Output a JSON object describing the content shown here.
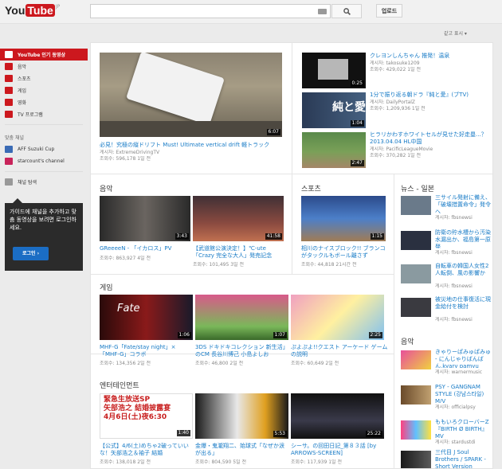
{
  "logo": {
    "you": "You",
    "tube": "Tube",
    "region": "JP"
  },
  "header": {
    "upload_label": "업로드",
    "show_hide": "같고 표시 ▾"
  },
  "guide": {
    "items": [
      {
        "label": "YouTube 인기 동영상"
      },
      {
        "label": "음악"
      },
      {
        "label": "스포츠"
      },
      {
        "label": "게임"
      },
      {
        "label": "영화"
      },
      {
        "label": "TV 프로그램"
      }
    ],
    "channels_heading": "맞춤 채널",
    "channels": [
      {
        "label": "AFF Suzuki Cup"
      },
      {
        "label": "starcount's channel"
      }
    ],
    "browse": "채널 탐색",
    "signin_text": "가이드에 채널을 추가하고 맞춤 동영상을 보려면 로그인하세요.",
    "signin_button": "로그인 ›"
  },
  "featured": {
    "main": {
      "duration": "6:07",
      "title": "必見！究極の縦ドリフト Must! Ultimate vertical drift 軽トラック",
      "channel": "게시자: ExtremeDrivingTV",
      "stats": "조회수: 596,178   1일 전"
    },
    "side": [
      {
        "duration": "0:25",
        "title": "クレヨンしんちゃん 推発！温泉",
        "channel": "게시자: takosuke1209",
        "stats": "조회수: 429,022   1일 전"
      },
      {
        "duration": "1:04",
        "title": "1分で振り返る朝ドラ『純と愛』(ブTV)",
        "channel": "게시자: DailyPortalZ",
        "stats": "조회수: 1,209,936   1일 전"
      },
      {
        "duration": "2:47",
        "title": "ヒラリかわすホワイトセルが見せた好走塁...？ 2013.04.04 HL中国",
        "channel": "게시자: PacificLeagueMovie",
        "stats": "조회수: 370,282   1일 전"
      }
    ]
  },
  "shelves": {
    "music": {
      "heading": "음악",
      "videos": [
        {
          "duration": "3:43",
          "title": "GReeeeN - 「イカロス」PV",
          "stats": "조회수: 863,927   4일 전"
        },
        {
          "duration": "41:58",
          "title": "【武道館公演決定！】℃-ute「Crazy 完全な大人」発売記念",
          "stats": "조회수: 101,495   3일 전"
        }
      ]
    },
    "sports": {
      "heading": "스포츠",
      "videos": [
        {
          "duration": "1:15",
          "title": "相川のナイスブロック!! ブランコがタックルもボール離さず",
          "stats": "조회수: 44,818   21시간 전"
        }
      ]
    },
    "games": {
      "heading": "게임",
      "videos": [
        {
          "duration": "1:06",
          "title": "MHF-G「Fate/stay night」×「MHF-G」コラボ",
          "stats": "조회수: 134,356   2일 전"
        },
        {
          "duration": "1:07",
          "title": "3DS ドキドキコレクション 新生活」のCM 長谷川博己 小島よしお",
          "stats": "조회수: 46,800   2일 전"
        },
        {
          "duration": "2:25",
          "title": "ぷよぷよ!!クエスト アーケード ゲームの説明",
          "stats": "조회수: 60,649   2일 전"
        }
      ]
    },
    "entertainment": {
      "heading": "엔터테인먼트",
      "videos": [
        {
          "duration": "1:40",
          "title": "【公式】4/6(土)めちゃ2破っていいな！矢部浩之＆袖子 結婚",
          "stats": "조회수: 138,018   2일 전"
        },
        {
          "duration": "5:53",
          "title": "金爆・鬼瀧翔二、始球式「なぜか涙が出る」",
          "stats": "조회수: 804,590   5일 전"
        },
        {
          "duration": "25:22",
          "title": "シーサ。の回田日記_第８３話 [by ARROWS-SCREEN]",
          "stats": "조회수: 117,939   1일 전"
        }
      ]
    }
  },
  "news": {
    "heading": "뉴스 - 일본",
    "items": [
      {
        "title": "三サイル発射に備え、「破壊措置命令」発令へ",
        "channel": "게시자: fbsnewsi"
      },
      {
        "title": "防衛の貯水槽から汚染水漏出か、福島第一原発",
        "channel": "게시자: fbsnewsi"
      },
      {
        "title": "自転車の韓国人女性2人転倒、風の影響か",
        "channel": "게시자: fbsnewsi"
      },
      {
        "title": "被災地の仕事復活に現金給付を検討",
        "channel": "게시자: fbsnewsi"
      }
    ]
  },
  "side_music": {
    "heading": "음악",
    "items": [
      {
        "title": "きゃりーぱみゅぱみゅ - にんじゃりばんばん,kyary pamyu",
        "channel": "게시자: warnermusic"
      },
      {
        "title": "PSY - GANGNAM STYLE (강남스타일) M/V",
        "channel": "게시자: officialpsy"
      },
      {
        "title": "ももいろクローバーZ『BIRTH Ø BIRTH』MV",
        "channel": "게시자: stardustdi"
      },
      {
        "title": "三代目 J Soul Brothers / SPARK - Short Version",
        "channel": ""
      }
    ]
  }
}
